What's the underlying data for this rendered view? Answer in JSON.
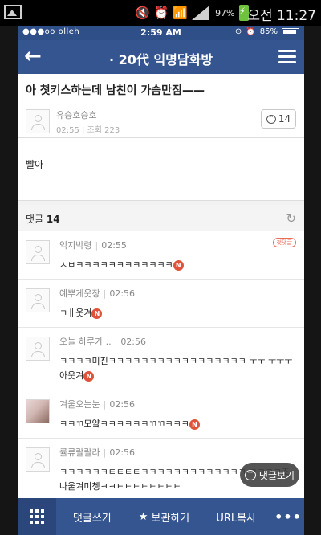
{
  "android_status": {
    "battery_pct": "97%",
    "clock": "오전 11:27"
  },
  "ios_status": {
    "carrier": "●●●oo olleh",
    "time": "2:59 AM",
    "battery": "85%"
  },
  "nav": {
    "title": "· 20代 익명담화방"
  },
  "post": {
    "title": "아 첫키스하는데 남친이 가슴만짐——",
    "author": "유승호승호",
    "time": "02:55",
    "views_label": "조회 223",
    "comment_count": "14",
    "body": "빨아"
  },
  "comments_header": {
    "label": "댓글",
    "count": "14"
  },
  "comments": [
    {
      "author": "익지박령",
      "time": "02:55",
      "text": "ㅅㅂㅋㅋㅋㅋㅋㅋㅋㅋㅋㅋㅋㅋ",
      "badge": "N",
      "first_badge": "첫댓글"
    },
    {
      "author": "예뿌게웃장",
      "time": "02:56",
      "text": "ㄱㅐ웃겨",
      "badge": "N"
    },
    {
      "author": "오늘 하루가 ..",
      "time": "02:56",
      "text": "ㅋㅋㅋㅋ미친ㅋㅋㅋㅋㅋㅋㅋㅋㅋㅋㅋㅋㅋㅋㅋㅋㅋ ㅜㅜ ㅜㅜㅜ아웃겨",
      "badge": "N"
    },
    {
      "author": "겨울오는눈",
      "time": "02:56",
      "text": "ㅋㅋㄲ모얔ㅋㅋㅋㅋㅋㅋㄲㄲㅋㅋㅋ",
      "badge": "N"
    },
    {
      "author": "률류랄랄라",
      "time": "02:56",
      "text": "ㅋㅋㅋㅋㅋㅋㅌㅌㅌㅌㅋㅋㅋㅋㅋㅋㅋㅋㅋㅋㅋㅋㅋ ㅋㅋㅋㅋ조나울겨미쳉ㅋㅋㅌㅌㅌㅌㅌㅌㅌㅌ"
    }
  ],
  "float_button": {
    "label": "댓글보기"
  },
  "bottom_bar": {
    "write": "댓글쓰기",
    "save": "보관하기",
    "copy": "URL복사",
    "more": "•••"
  }
}
